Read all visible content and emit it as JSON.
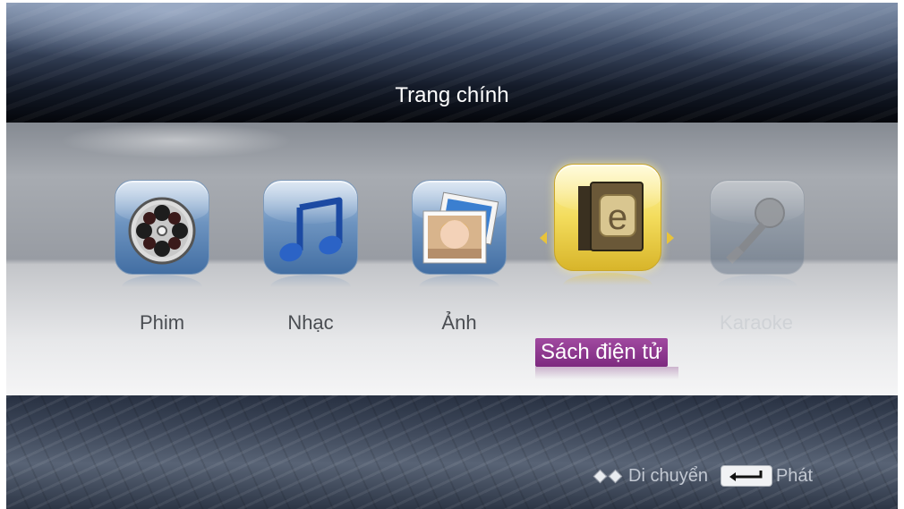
{
  "header": {
    "title": "Trang chính"
  },
  "menu": {
    "items": [
      {
        "label": "Phim",
        "icon": "film-reel-icon"
      },
      {
        "label": "Nhạc",
        "icon": "music-note-icon"
      },
      {
        "label": "Ảnh",
        "icon": "photo-icon"
      },
      {
        "label": "Sách điện tử",
        "icon": "ebook-icon",
        "selected": true
      },
      {
        "label": "Karaoke",
        "icon": "microphone-icon",
        "disabled": true
      }
    ]
  },
  "footer": {
    "move_hint": "Di chuyển",
    "play_hint": "Phát",
    "move_icon": "left-right-diamonds-icon",
    "play_icon": "enter-key-icon"
  },
  "colors": {
    "selected_tile": "#f3dc5c",
    "selected_label_bg": "#7d2a7f",
    "tile_blue": "#6e94c0"
  }
}
